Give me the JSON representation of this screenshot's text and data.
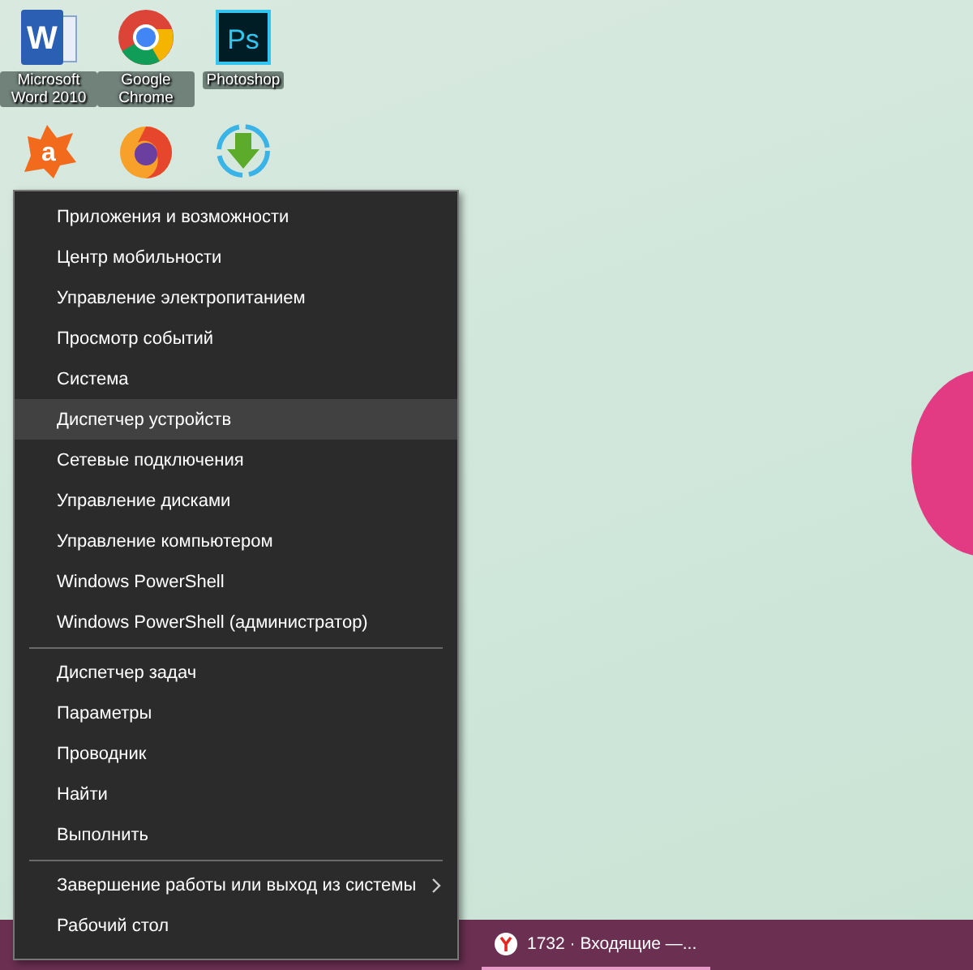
{
  "desktop_icons": [
    {
      "kind": "word",
      "glyph": "W",
      "label": "Microsoft Word 2010"
    },
    {
      "kind": "chrome",
      "label": "Google Chrome"
    },
    {
      "kind": "photoshop",
      "glyph": "Ps",
      "label": "Photoshop"
    },
    {
      "kind": "avast",
      "glyph": "a"
    },
    {
      "kind": "firefox"
    },
    {
      "kind": "download"
    }
  ],
  "context_menu": {
    "groups": [
      [
        {
          "label": "Приложения и возможности",
          "selected": false,
          "submenu": false
        },
        {
          "label": "Центр мобильности",
          "selected": false,
          "submenu": false
        },
        {
          "label": "Управление электропитанием",
          "selected": false,
          "submenu": false
        },
        {
          "label": "Просмотр событий",
          "selected": false,
          "submenu": false
        },
        {
          "label": "Система",
          "selected": false,
          "submenu": false
        },
        {
          "label": "Диспетчер устройств",
          "selected": true,
          "submenu": false
        },
        {
          "label": "Сетевые подключения",
          "selected": false,
          "submenu": false
        },
        {
          "label": "Управление дисками",
          "selected": false,
          "submenu": false
        },
        {
          "label": "Управление компьютером",
          "selected": false,
          "submenu": false
        },
        {
          "label": "Windows PowerShell",
          "selected": false,
          "submenu": false
        },
        {
          "label": "Windows PowerShell (администратор)",
          "selected": false,
          "submenu": false
        }
      ],
      [
        {
          "label": "Диспетчер задач",
          "selected": false,
          "submenu": false
        },
        {
          "label": "Параметры",
          "selected": false,
          "submenu": false
        },
        {
          "label": "Проводник",
          "selected": false,
          "submenu": false
        },
        {
          "label": "Найти",
          "selected": false,
          "submenu": false
        },
        {
          "label": "Выполнить",
          "selected": false,
          "submenu": false
        }
      ],
      [
        {
          "label": "Завершение работы или выход из системы",
          "selected": false,
          "submenu": true
        },
        {
          "label": "Рабочий стол",
          "selected": false,
          "submenu": false
        }
      ]
    ]
  },
  "taskbar": {
    "items": [
      {
        "label": "1732 · Входящие —...",
        "running": true
      }
    ]
  }
}
